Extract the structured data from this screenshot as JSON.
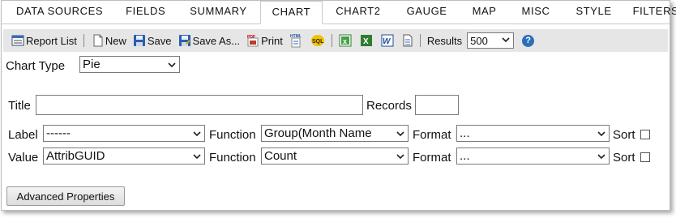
{
  "tabs": [
    "DATA SOURCES",
    "FIELDS",
    "SUMMARY",
    "CHART",
    "CHART2",
    "GAUGE",
    "MAP",
    "MISC",
    "STYLE",
    "FILTERS"
  ],
  "active_tab": "CHART",
  "toolbar": {
    "report_list": "Report List",
    "new": "New",
    "save": "Save",
    "save_as": "Save As...",
    "print": "Print",
    "results_label": "Results",
    "results_value": "500"
  },
  "form": {
    "chart_type_label": "Chart Type",
    "chart_type_value": "Pie",
    "title_label": "Title",
    "title_value": "",
    "records_label": "Records",
    "records_value": "",
    "label_row": {
      "label": "Label",
      "field": "------",
      "function_label": "Function",
      "function": "Group(Month Name",
      "format_label": "Format",
      "format": "...",
      "sort_label": "Sort"
    },
    "value_row": {
      "label": "Value",
      "field": "AttribGUID",
      "function_label": "Function",
      "function": "Count",
      "format_label": "Format",
      "format": "...",
      "sort_label": "Sort"
    },
    "advanced_button": "Advanced Properties"
  }
}
